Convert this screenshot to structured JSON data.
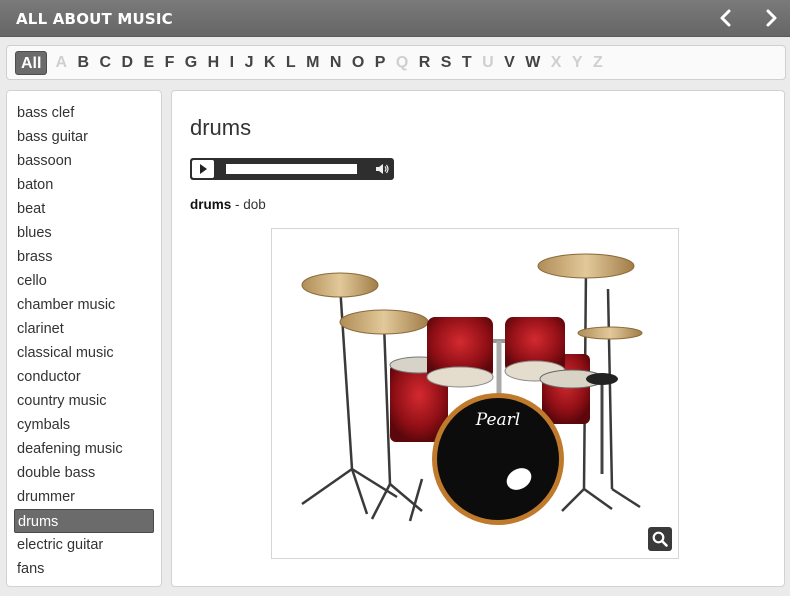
{
  "header": {
    "title": "ALL ABOUT MUSIC",
    "prev_icon": "chevron-left-icon",
    "next_icon": "chevron-right-icon"
  },
  "letters": [
    {
      "label": "All",
      "state": "active"
    },
    {
      "label": "A",
      "state": "disabled"
    },
    {
      "label": "B",
      "state": "enabled"
    },
    {
      "label": "C",
      "state": "enabled"
    },
    {
      "label": "D",
      "state": "enabled"
    },
    {
      "label": "E",
      "state": "enabled"
    },
    {
      "label": "F",
      "state": "enabled"
    },
    {
      "label": "G",
      "state": "enabled"
    },
    {
      "label": "H",
      "state": "enabled"
    },
    {
      "label": "I",
      "state": "enabled"
    },
    {
      "label": "J",
      "state": "enabled"
    },
    {
      "label": "K",
      "state": "enabled"
    },
    {
      "label": "L",
      "state": "enabled"
    },
    {
      "label": "M",
      "state": "enabled"
    },
    {
      "label": "N",
      "state": "enabled"
    },
    {
      "label": "O",
      "state": "enabled"
    },
    {
      "label": "P",
      "state": "enabled"
    },
    {
      "label": "Q",
      "state": "disabled"
    },
    {
      "label": "R",
      "state": "enabled"
    },
    {
      "label": "S",
      "state": "enabled"
    },
    {
      "label": "T",
      "state": "enabled"
    },
    {
      "label": "U",
      "state": "disabled"
    },
    {
      "label": "V",
      "state": "enabled"
    },
    {
      "label": "W",
      "state": "enabled"
    },
    {
      "label": "X",
      "state": "disabled"
    },
    {
      "label": "Y",
      "state": "disabled"
    },
    {
      "label": "Z",
      "state": "disabled"
    }
  ],
  "sidebar": {
    "items": [
      "bass clef",
      "bass guitar",
      "bassoon",
      "baton",
      "beat",
      "blues",
      "brass",
      "cello",
      "chamber music",
      "clarinet",
      "classical music",
      "conductor",
      "country music",
      "cymbals",
      "deafening music",
      "double bass",
      "drummer",
      "drums",
      "electric guitar",
      "fans"
    ],
    "selected": "drums"
  },
  "entry": {
    "word": "drums",
    "term": "drums",
    "separator": " - ",
    "translation": "dob",
    "audio": {
      "play_icon": "play-icon",
      "volume_icon": "volume-icon"
    },
    "image_icon": "drum-kit-photo",
    "zoom_icon": "magnifier-icon",
    "brand_text": "Pearl"
  },
  "colors": {
    "header_bg": "#6e6e6e",
    "active_bg": "#6b6b6b",
    "drum_red": "#a3141c",
    "cymbal_gold": "#c9a871"
  }
}
